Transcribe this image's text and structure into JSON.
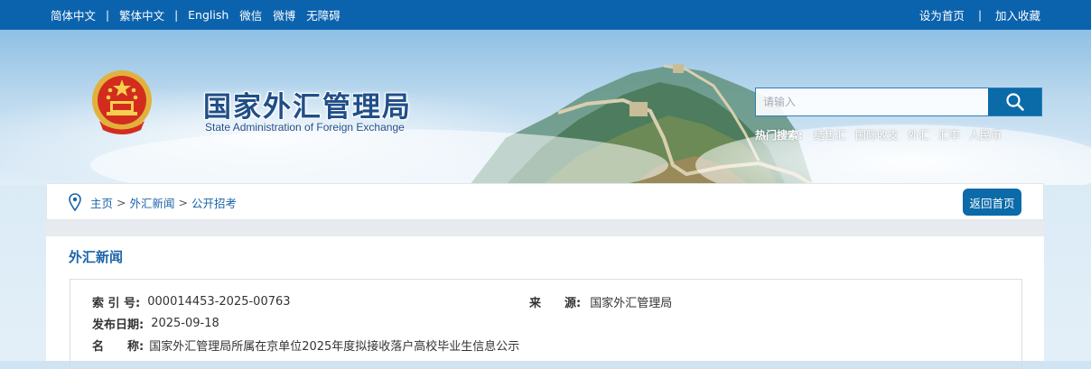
{
  "topbar": {
    "simplified": "简体中文",
    "traditional": "繁体中文",
    "english": "English",
    "wechat": "微信",
    "weibo": "微博",
    "accessibility": "无障碍",
    "set_home": "设为首页",
    "add_favorite": "加入收藏",
    "separator": "|"
  },
  "header": {
    "title": "国家外汇管理局",
    "subtitle": "State Administration of Foreign Exchange"
  },
  "search": {
    "placeholder": "请输入",
    "hot_label": "热门搜索:",
    "hot_items": [
      "结售汇",
      "国际收支",
      "外汇",
      "汇率",
      "人民币"
    ]
  },
  "breadcrumb": {
    "home": "主页",
    "news": "外汇新闻",
    "current": "公开招考",
    "arrow": ">",
    "back_home": "返回首页"
  },
  "main": {
    "section_title": "外汇新闻",
    "index_label": "索 引 号:",
    "index_value": "000014453-2025-00763",
    "source_label": "来　　源:",
    "source_value": "国家外汇管理局",
    "date_label": "发布日期:",
    "date_value": "2025-09-18",
    "name_label": "名　　称:",
    "name_value": "国家外汇管理局所属在京单位2025年度拟接收落户高校毕业生信息公示"
  },
  "colors": {
    "primary": "#0b63ad",
    "link": "#1b64a8",
    "button": "#0b6aa8"
  }
}
